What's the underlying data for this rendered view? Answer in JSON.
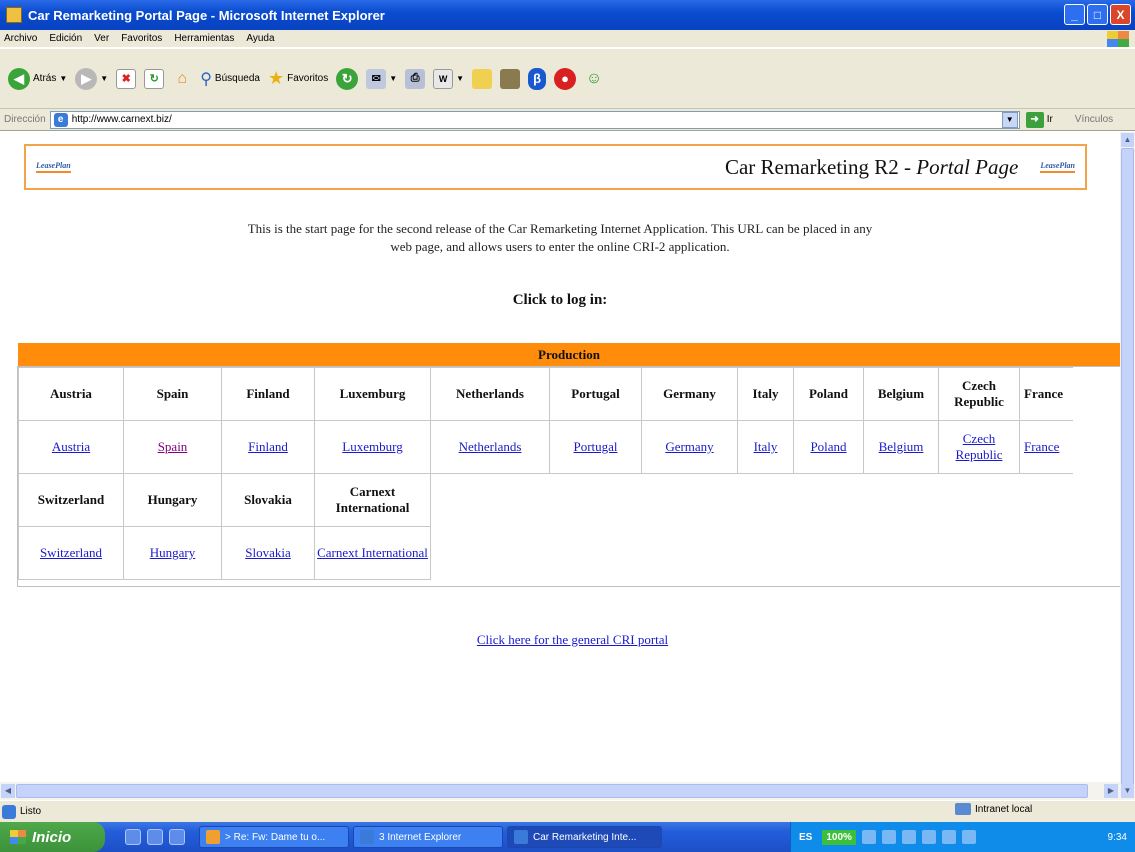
{
  "window": {
    "title": "Car Remarketing Portal Page - Microsoft Internet Explorer",
    "minimize": "_",
    "maximize": "□",
    "close": "X"
  },
  "menubar": {
    "items": [
      "Archivo",
      "Edición",
      "Ver",
      "Favoritos",
      "Herramientas",
      "Ayuda"
    ]
  },
  "toolbar": {
    "back_label": "Atrás",
    "search_label": "Búsqueda",
    "favorites_label": "Favoritos"
  },
  "addressbar": {
    "label": "Dirección",
    "url": "http://www.carnext.biz/",
    "go_label": "Ir",
    "links_label": "Vínculos"
  },
  "page": {
    "header_title_prefix": "Car Remarketing R2 - ",
    "header_title_italic": "Portal Page",
    "logo_text": "LeasePlan",
    "intro_line1": "This is the start page for the second release of the Car Remarketing Internet Application. This URL can be placed in any",
    "intro_line2": "web page, and allows users to enter the online CRI-2 application.",
    "click_to_login": "Click to log in:",
    "production_label": "Production",
    "countries_row1": [
      "Austria",
      "Spain",
      "Finland",
      "Luxemburg",
      "Netherlands",
      "Portugal",
      "Germany",
      "Italy",
      "Poland",
      "Belgium",
      "Czech Republic",
      "France"
    ],
    "countries_row2": [
      "Switzerland",
      "Hungary",
      "Slovakia",
      "Carnext International"
    ],
    "general_portal_link": "Click here for the general CRI portal"
  },
  "statusbar": {
    "status": "Listo",
    "zone": "Intranet local"
  },
  "taskbar": {
    "start_label": "Inicio",
    "tasks": [
      "> Re: Fw: Dame tu o...",
      "3 Internet Explorer",
      "Car Remarketing Inte..."
    ],
    "language": "ES",
    "zoom": "100%",
    "clock": "9:34"
  }
}
